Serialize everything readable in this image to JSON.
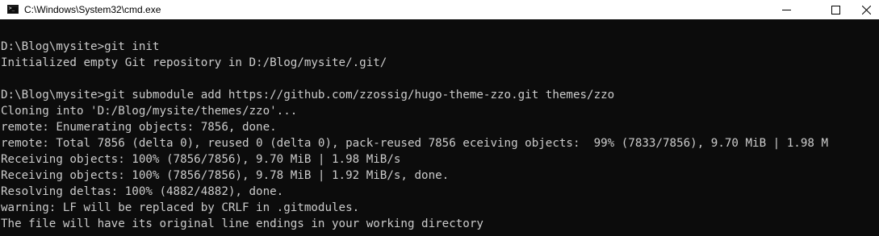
{
  "window": {
    "title": "C:\\Windows\\System32\\cmd.exe",
    "icon": "cmd-console-icon",
    "controls": {
      "minimize_icon": "minimize-icon",
      "maximize_icon": "maximize-icon",
      "close_icon": "close-icon"
    }
  },
  "colors": {
    "background": "#0c0c0c",
    "foreground": "#cccccc",
    "titlebar": "#ffffff"
  },
  "console": {
    "lines": [
      "D:\\Blog\\mysite>git init",
      "Initialized empty Git repository in D:/Blog/mysite/.git/",
      "",
      "D:\\Blog\\mysite>git submodule add https://github.com/zzossig/hugo-theme-zzo.git themes/zzo",
      "Cloning into 'D:/Blog/mysite/themes/zzo'...",
      "remote: Enumerating objects: 7856, done.",
      "remote: Total 7856 (delta 0), reused 0 (delta 0), pack-reused 7856 eceiving objects:  99% (7833/7856), 9.70 MiB | 1.98 M",
      "Receiving objects: 100% (7856/7856), 9.70 MiB | 1.98 MiB/s",
      "Receiving objects: 100% (7856/7856), 9.78 MiB | 1.92 MiB/s, done.",
      "Resolving deltas: 100% (4882/4882), done.",
      "warning: LF will be replaced by CRLF in .gitmodules.",
      "The file will have its original line endings in your working directory"
    ]
  }
}
